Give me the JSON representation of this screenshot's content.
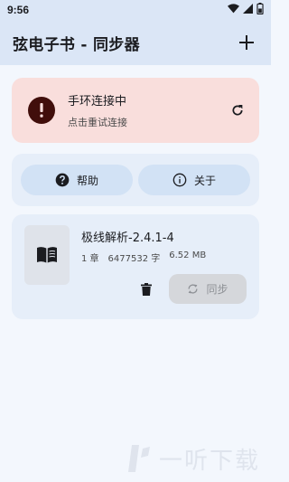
{
  "status_bar": {
    "time": "9:56",
    "icons": [
      "wifi-icon",
      "signal-icon",
      "battery-icon"
    ]
  },
  "app_bar": {
    "title": "弦电子书 - 同步器",
    "add_icon": "add-icon"
  },
  "connection_card": {
    "title": "手环连接中",
    "subtitle": "点击重试连接",
    "icon": "error-icon",
    "action_icon": "refresh-icon",
    "background": "#f9dedc"
  },
  "actions": {
    "help_label": "帮助",
    "about_label": "关于"
  },
  "book": {
    "title": "极线解析-2.4.1-4",
    "chapters": "1 章",
    "chars": "6477532 字",
    "size": "6.52 MB",
    "cover_icon": "book-icon",
    "delete_icon": "delete-icon",
    "sync_label": "同步",
    "sync_icon": "sync-icon"
  },
  "watermark": {
    "text": "一听下载"
  },
  "colors": {
    "app_bar": "#dbe6f6",
    "background": "#f3f7fd",
    "card": "#e6eef9",
    "error_card": "#f9dedc",
    "pill": "#d2e2f5",
    "sync_disabled": "#d5d7db"
  }
}
